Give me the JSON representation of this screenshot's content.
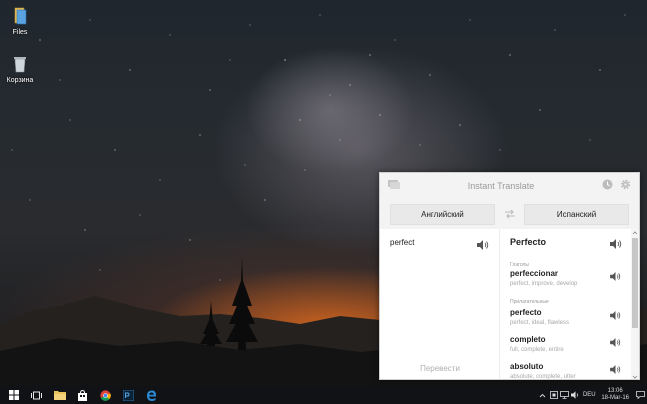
{
  "desktop": {
    "icons": [
      {
        "label": "Files",
        "icon": "folder-icon"
      },
      {
        "label": "Корзина",
        "icon": "recycle-bin-icon"
      }
    ]
  },
  "window": {
    "title": "Instant Translate",
    "source_lang": "Английский",
    "target_lang": "Испанский",
    "source_text": "perfect",
    "translate_button": "Перевести",
    "main_translation": "Perfecto",
    "groups": [
      {
        "label": "Глаголы",
        "entries": [
          {
            "word": "perfeccionar",
            "synonyms": "perfect, improve, develop"
          }
        ]
      },
      {
        "label": "Прилагательные",
        "entries": [
          {
            "word": "perfecto",
            "synonyms": "perfect, ideal, flawless"
          },
          {
            "word": "completo",
            "synonyms": "full, complete, entire"
          },
          {
            "word": "absoluto",
            "synonyms": "absolute, complete, utter"
          }
        ]
      }
    ]
  },
  "taskbar": {
    "language": "DEU",
    "time": "13:06",
    "date": "18-Mar-16"
  },
  "colors": {
    "taskbar_bg": "#101215",
    "window_header_bg": "#f3f3f3",
    "edge_blue": "#2a8ad6",
    "photoshop_blue": "#2f7fc0"
  }
}
